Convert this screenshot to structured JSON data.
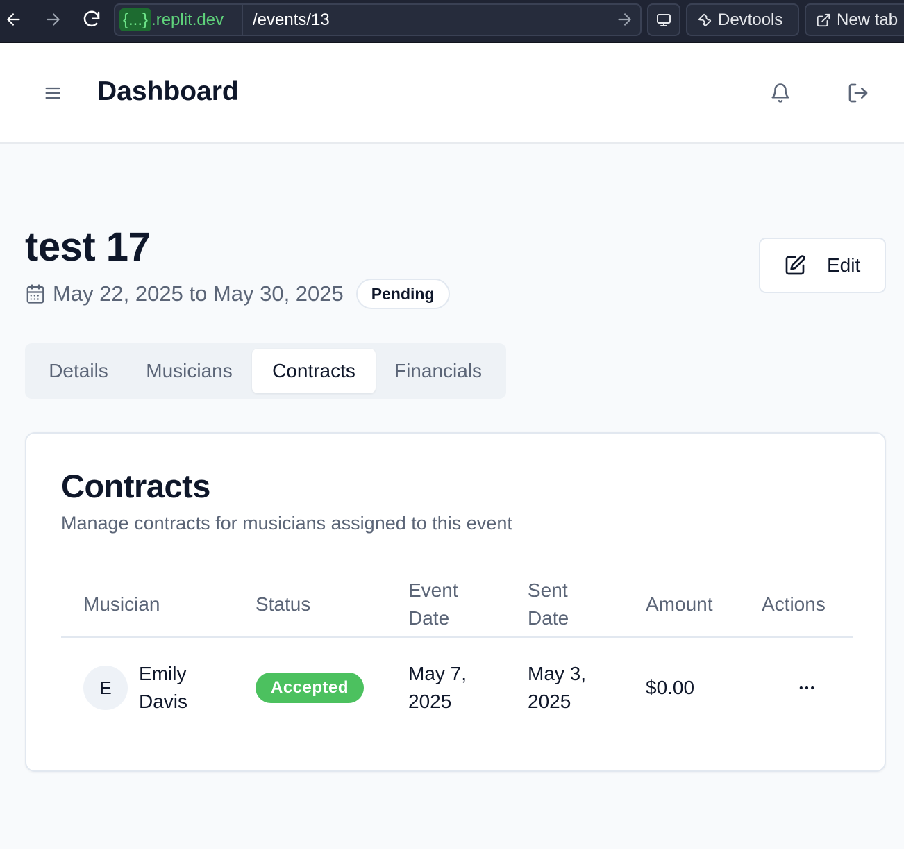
{
  "browser": {
    "url_badge": "{...}",
    "url_host": ".replit.dev",
    "url_path": "/events/13",
    "devtools_label": "Devtools",
    "newtab_label": "New tab"
  },
  "header": {
    "title": "Dashboard"
  },
  "event": {
    "title": "test 17",
    "date_range": "May 22, 2025 to May 30, 2025",
    "status": "Pending",
    "edit_label": "Edit"
  },
  "tabs": [
    {
      "label": "Details",
      "active": false
    },
    {
      "label": "Musicians",
      "active": false
    },
    {
      "label": "Contracts",
      "active": true
    },
    {
      "label": "Financials",
      "active": false
    }
  ],
  "contracts": {
    "title": "Contracts",
    "subtitle": "Manage contracts for musicians assigned to this event",
    "columns": {
      "musician": "Musician",
      "status": "Status",
      "event_date_1": "Event",
      "event_date_2": "Date",
      "sent_date_1": "Sent",
      "sent_date_2": "Date",
      "amount": "Amount",
      "actions": "Actions"
    },
    "rows": [
      {
        "avatar_initial": "E",
        "name_1": "Emily",
        "name_2": "Davis",
        "status": "Accepted",
        "event_date_1": "May 7,",
        "event_date_2": "2025",
        "sent_date_1": "May 3,",
        "sent_date_2": "2025",
        "amount": "$0.00",
        "actions_icon": "more-horizontal-icon"
      }
    ]
  },
  "colors": {
    "accent_green": "#4cc15f",
    "chrome_bg": "#1f2433",
    "text_primary": "#0f172a",
    "text_muted": "#5b6577"
  }
}
